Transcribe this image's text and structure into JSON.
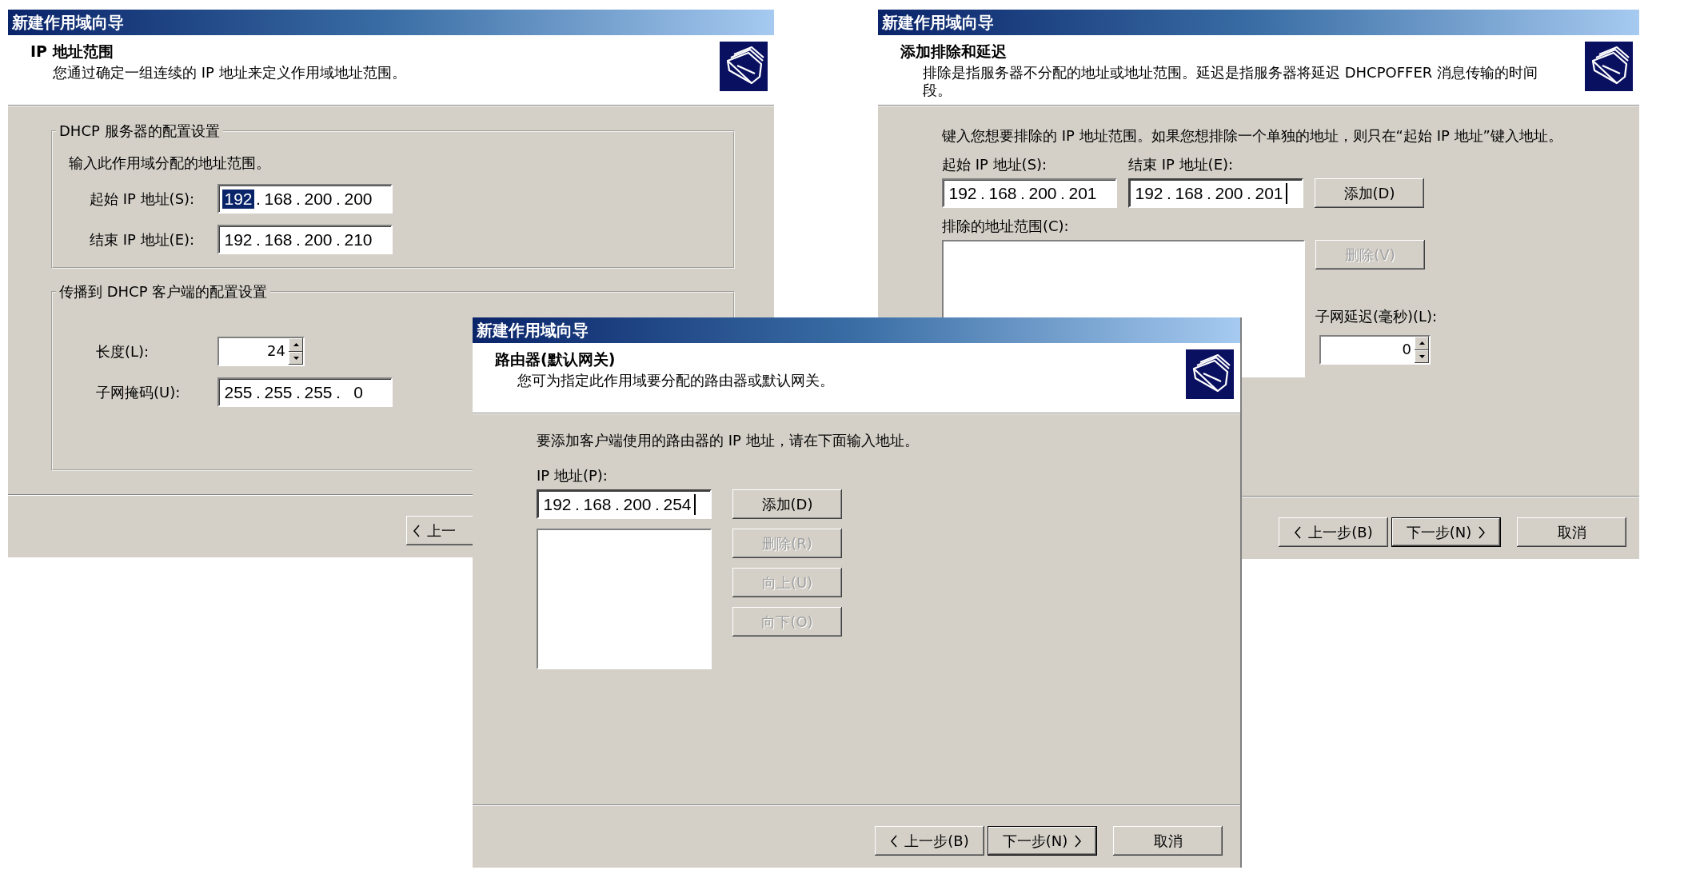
{
  "windows": [
    {
      "kind": "range",
      "title": "新建作用域向导",
      "header": {
        "title": "IP 地址范围",
        "description": "您通过确定一组连续的 IP 地址来定义作用域地址范围。"
      },
      "groups": [
        {
          "legend": "DHCP 服务器的配置设置",
          "items": [
            {
              "kind": "note",
              "text": "输入此作用域分配的地址范围。"
            },
            {
              "kind": "ip",
              "label": "起始 IP 地址(S):",
              "focused": false,
              "separator": ".",
              "octets": [
                {
                  "text": "192",
                  "selected": true
                },
                {
                  "text": "168",
                  "selected": false
                },
                {
                  "text": "200",
                  "selected": false
                },
                {
                  "text": "200",
                  "selected": false
                }
              ]
            },
            {
              "kind": "ip",
              "label": "结束 IP 地址(E):",
              "focused": false,
              "separator": ".",
              "octets": [
                {
                  "text": "192",
                  "selected": false
                },
                {
                  "text": "168",
                  "selected": false
                },
                {
                  "text": "200",
                  "selected": false
                },
                {
                  "text": "210",
                  "selected": false
                }
              ]
            }
          ]
        },
        {
          "legend": "传播到 DHCP 客户端的配置设置",
          "items": [
            {
              "kind": "spinner",
              "label": "长度(L):",
              "value": "24"
            },
            {
              "kind": "ip",
              "label": "子网掩码(U):",
              "focused": false,
              "separator": ".",
              "octets": [
                {
                  "text": "255",
                  "selected": false
                },
                {
                  "text": "255",
                  "selected": false
                },
                {
                  "text": "255",
                  "selected": false
                },
                {
                  "text": "0",
                  "selected": false
                }
              ]
            }
          ]
        }
      ],
      "footer": [
        {
          "kind": "back",
          "label": "上一",
          "default": false
        }
      ]
    },
    {
      "kind": "exclusions",
      "title": "新建作用域向导",
      "header": {
        "title": "添加排除和延迟",
        "description": "排除是指服务器不分配的地址或地址范围。延迟是指服务器将延迟 DHCPOFFER 消息传输的时间段。"
      },
      "instruction": "键入您想要排除的 IP 地址范围。如果您想排除一个单独的地址，则只在“起始 IP 地址”键入地址。",
      "range_fields": [
        {
          "label": "起始 IP 地址(S):",
          "focused": false,
          "separator": ".",
          "octets": [
            {
              "text": "192",
              "selected": false
            },
            {
              "text": "168",
              "selected": false
            },
            {
              "text": "200",
              "selected": false
            },
            {
              "text": "201",
              "selected": false
            }
          ]
        },
        {
          "label": "结束 IP 地址(E):",
          "focused": true,
          "separator": ".",
          "octets": [
            {
              "text": "192",
              "selected": false
            },
            {
              "text": "168",
              "selected": false
            },
            {
              "text": "200",
              "selected": false
            },
            {
              "text": "201",
              "selected": false
            }
          ]
        }
      ],
      "add_button": {
        "label": "添加(D)",
        "disabled": false
      },
      "list_label": "排除的地址范围(C):",
      "remove_button": {
        "label": "删除(V)",
        "disabled": true
      },
      "delay": {
        "label": "子网延迟(毫秒)(L):",
        "value": "0"
      },
      "footer": [
        {
          "kind": "back",
          "label": "上一步(B)",
          "default": false
        },
        {
          "kind": "next",
          "label": "下一步(N)",
          "default": true
        },
        {
          "kind": "cancel",
          "label": "取消",
          "default": false
        }
      ]
    },
    {
      "kind": "router",
      "title": "新建作用域向导",
      "header": {
        "title": "路由器(默认网关)",
        "description": "您可为指定此作用域要分配的路由器或默认网关。"
      },
      "instruction": "要添加客户端使用的路由器的 IP 地址，请在下面输入地址。",
      "address_field": {
        "label": "IP 地址(P):",
        "focused": true,
        "separator": ".",
        "octets": [
          {
            "text": "192",
            "selected": false
          },
          {
            "text": "168",
            "selected": false
          },
          {
            "text": "200",
            "selected": false
          },
          {
            "text": "254",
            "selected": false
          }
        ]
      },
      "buttons": [
        {
          "label": "添加(D)",
          "disabled": false
        },
        {
          "label": "删除(R)",
          "disabled": true
        },
        {
          "label": "向上(U)",
          "disabled": true
        },
        {
          "label": "向下(O)",
          "disabled": true
        }
      ],
      "footer": [
        {
          "kind": "back",
          "label": "上一步(B)",
          "default": false
        },
        {
          "kind": "next",
          "label": "下一步(N)",
          "default": true
        },
        {
          "kind": "cancel",
          "label": "取消",
          "default": false
        }
      ]
    }
  ]
}
